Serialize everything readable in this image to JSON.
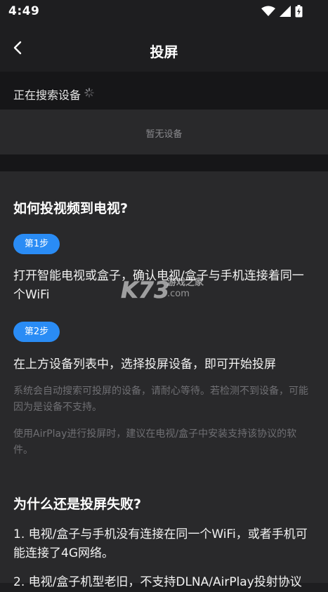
{
  "status": {
    "time": "4:49"
  },
  "nav": {
    "title": "投屏"
  },
  "search": {
    "label": "正在搜索设备"
  },
  "devices": {
    "empty_text": "暂无设备"
  },
  "help": {
    "title": "如何投视频到电视?",
    "steps": [
      {
        "badge": "第1步",
        "text": "打开智能电视或盒子，确认电视/盒子与手机连接着同一个WiFi"
      },
      {
        "badge": "第2步",
        "text": "在上方设备列表中，选择投屏设备，即可开始投屏"
      }
    ],
    "notes": [
      "系统会自动搜索可投屏的设备，请耐心等待。若检测不到设备，可能因为是设备不支持。",
      "使用AirPlay进行投屏时，建议在电视/盒子中安装支持该协议的软件。"
    ],
    "fail_title": "为什么还是投屏失败?",
    "fail_items": [
      "1. 电视/盒子与手机没有连接在同一个WiFi，或者手机可能连接了4G网络。",
      "2. 电视/盒子机型老旧，不支持DLNA/AirPlay投射协议"
    ]
  },
  "watermark": {
    "brand": "K73",
    "sub": "游戏之家",
    "domain": ".com"
  },
  "colors": {
    "accent": "#2a8cf5",
    "background": "#1e1e20",
    "card": "#29292b"
  }
}
